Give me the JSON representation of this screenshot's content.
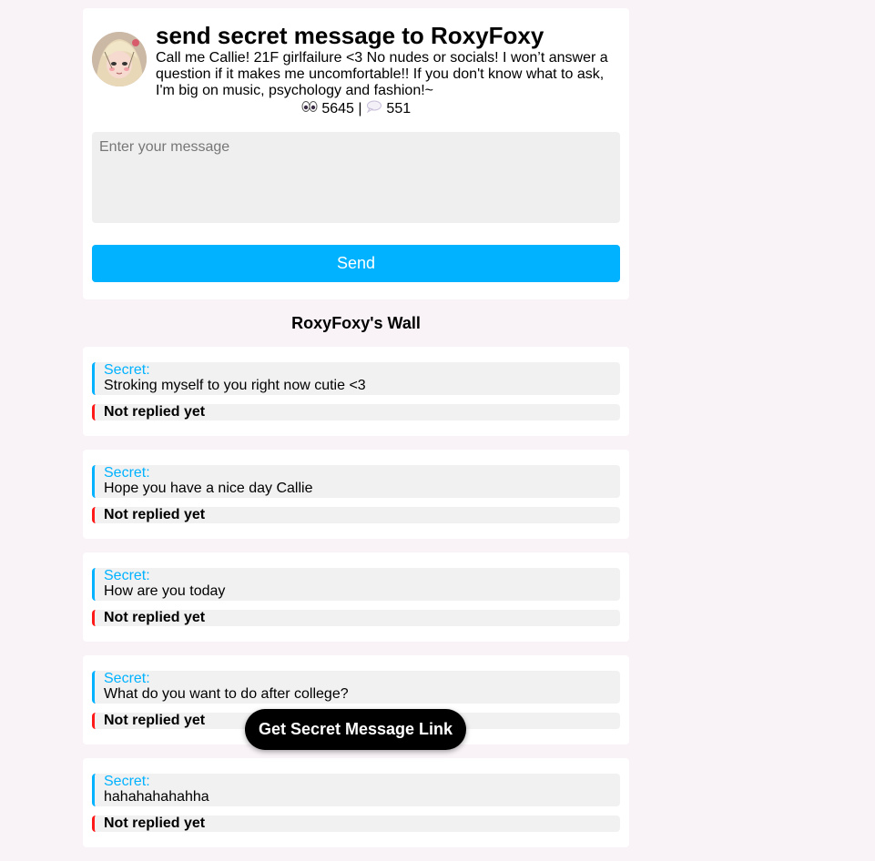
{
  "profile": {
    "title": "send secret message to RoxyFoxy",
    "bio": "Call me Callie! 21F girlfailure <3 No nudes or socials! I won’t answer a question if it makes me uncomfortable!! If you don't know what to ask, I'm big on music, psychology and fashion!~",
    "views": "5645",
    "separator": "|",
    "messages": "551",
    "avatar_icon": "avatar-illustration"
  },
  "composer": {
    "placeholder": "Enter your message",
    "send_label": "Send"
  },
  "wall": {
    "title": "RoxyFoxy's Wall",
    "posts": [
      {
        "label": "Secret:",
        "text": "Stroking myself to you right now cutie <3",
        "reply": "Not replied yet"
      },
      {
        "label": "Secret:",
        "text": "Hope you have a nice day Callie",
        "reply": "Not replied yet"
      },
      {
        "label": "Secret:",
        "text": "How are you today",
        "reply": "Not replied yet"
      },
      {
        "label": "Secret:",
        "text": "What do you want to do after college?",
        "reply": "Not replied yet"
      },
      {
        "label": "Secret:",
        "text": "hahahahahahha",
        "reply": "Not replied yet"
      }
    ]
  },
  "floating_button": {
    "label": "Get Secret Message Link"
  },
  "colors": {
    "accent": "#00b2ff",
    "not_replied": "#ff1a1a",
    "background": "#f9f3f7"
  }
}
